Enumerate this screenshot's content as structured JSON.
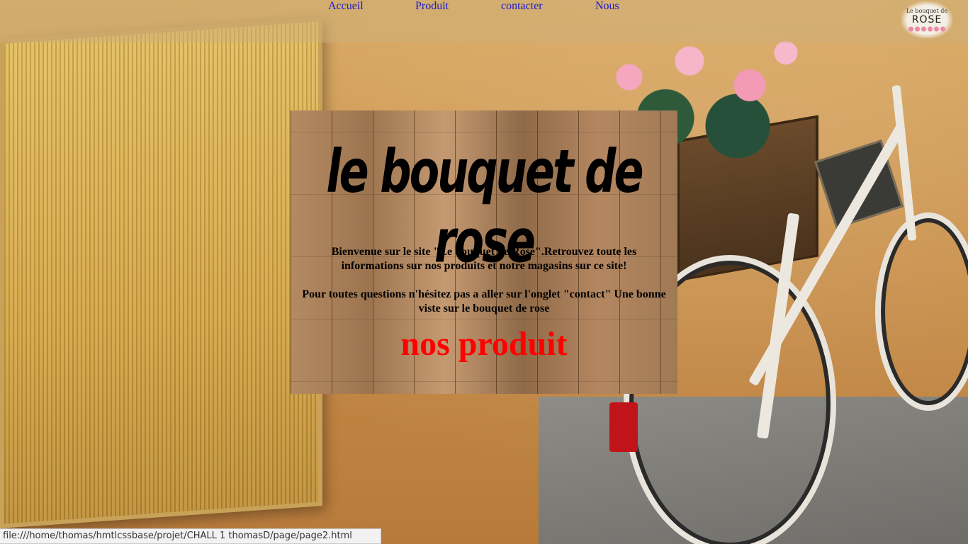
{
  "nav": {
    "items": [
      {
        "label": "Accueil"
      },
      {
        "label": "Produit"
      },
      {
        "label": "contacter"
      },
      {
        "label": "Nous"
      }
    ],
    "link_color": "#1a1acc"
  },
  "logo": {
    "small_text": "Le bouquet de",
    "big_text": "ROSE"
  },
  "hero": {
    "title": "le bouquet de rose",
    "intro_1": "Bienvenue sur le site \"Le bouquet de Rose\".Retrouvez toute les informations sur nos produits et notre magasins sur ce site!",
    "intro_2": "Pour toutes questions n'hésitez pas a aller sur l'onglet \"contact\" Une bonne viste sur le bouquet de rose",
    "section_title": "nos produit",
    "section_title_color": "#ff0000"
  },
  "statusbar": {
    "url": "file:///home/thomas/hmtlcssbase/projet/CHALL 1 thomasD/page/page2.html"
  }
}
